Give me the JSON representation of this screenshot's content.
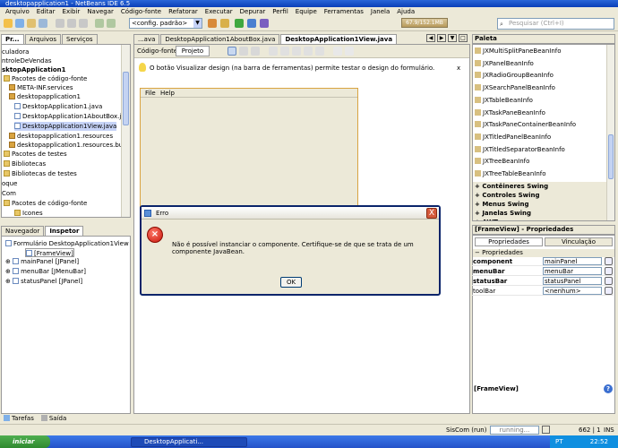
{
  "window": {
    "title": "desktopapplication1 - NetBeans IDE 6.5"
  },
  "menu": [
    "Arquivo",
    "Editar",
    "Exibir",
    "Navegar",
    "Código-fonte",
    "Refatorar",
    "Executar",
    "Depurar",
    "Perfil",
    "Equipe",
    "Ferramentas",
    "Janela",
    "Ajuda"
  ],
  "toolbar": {
    "config": "<config. padrão>",
    "memory": "67.9/152.1MB",
    "search_placeholder": "Pesquisar (Ctrl+I)"
  },
  "projects": {
    "tabs": [
      "Pr...",
      "Arquivos",
      "Serviços"
    ],
    "items": [
      "culadora",
      "ntroleDeVendas",
      "sktopApplication1",
      "Pacotes de código-fonte",
      "META-INF.services",
      "desktopapplication1",
      "DesktopApplication1.java",
      "DesktopApplication1AboutBox.java",
      "DesktopApplication1View.java",
      "desktopapplication1.resources",
      "desktopapplication1.resources.busyicons",
      "Pacotes de testes",
      "Bibliotecas",
      "Bibliotecas de testes",
      "oque",
      "Com",
      "Pacotes de código-fonte",
      "Icones"
    ]
  },
  "navigator": {
    "tabs": [
      "Navegador",
      "Inspetor"
    ],
    "items": [
      "Formulário DesktopApplication1View",
      "[FrameView]",
      "mainPanel [JPanel]",
      "menuBar [JMenuBar]",
      "statusPanel [JPanel]"
    ]
  },
  "editor": {
    "tabs": [
      "...ava",
      "DesktopApplication1AboutBox.java",
      "DesktopApplication1View.java"
    ],
    "subtabs": [
      "Código-fonte",
      "Projeto"
    ],
    "hint": "O botão Visualizar design (na barra de ferramentas) permite testar o design do formulário.",
    "hint_close": "x",
    "form_menu": [
      "File",
      "Help"
    ]
  },
  "palette": {
    "title": "Paleta",
    "items": [
      "JXMultiSplitPaneBeanInfo",
      "JXPanelBeanInfo",
      "JXRadioGroupBeanInfo",
      "JXSearchPanelBeanInfo",
      "JXTableBeanInfo",
      "JXTaskPaneBeanInfo",
      "JXTaskPaneContainerBeanInfo",
      "JXTitledPanelBeanInfo",
      "JXTitledSeparatorBeanInfo",
      "JXTreeBeanInfo",
      "JXTreeTableBeanInfo"
    ],
    "sections": [
      "Contêineres Swing",
      "Controles Swing",
      "Menus Swing",
      "Janelas Swing",
      "AWT"
    ]
  },
  "properties": {
    "title": "[FrameView] - Propriedades",
    "tabs": [
      "Propriedades",
      "Vinculação"
    ],
    "group": "Propriedades",
    "rows": [
      {
        "k": "component",
        "v": "mainPanel"
      },
      {
        "k": "menuBar",
        "v": "menuBar"
      },
      {
        "k": "statusBar",
        "v": "statusPanel"
      },
      {
        "k": "toolBar",
        "v": "<nenhum>"
      }
    ],
    "footer": "[FrameView]"
  },
  "dialog": {
    "title": "Erro",
    "message": "Não é possível instanciar o componente.  Certifique-se de que se trata de um componente JavaBean.",
    "ok": "OK",
    "close": "X"
  },
  "bottom_tabs": [
    "Tarefas",
    "Saída"
  ],
  "status": {
    "project": "SisCom (run)",
    "progress": "running...",
    "pos": "662 | 1",
    "mode": "INS"
  },
  "taskbar": {
    "start": "iniciar",
    "window": "DesktopApplicati...",
    "lang": "PT",
    "clock": "22:52"
  }
}
